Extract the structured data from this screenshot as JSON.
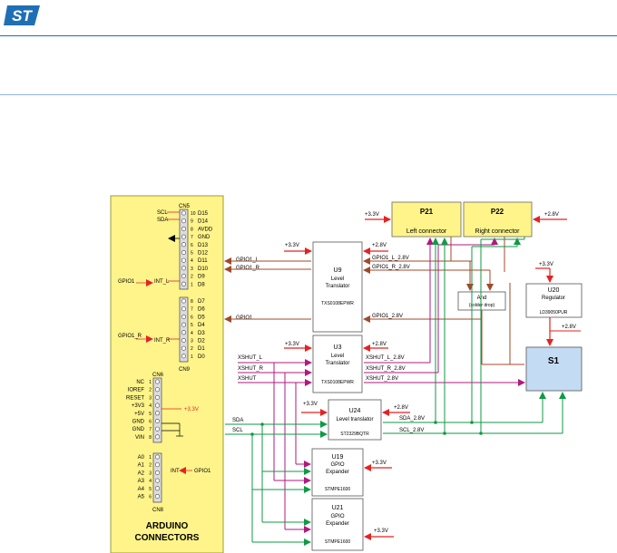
{
  "logo_text": "ST",
  "colors": {
    "yellow": "#fff48a",
    "red": "#e52222",
    "green": "#0f9a46",
    "brown": "#a04a2a",
    "magenta": "#b2187f",
    "blue": "#1f6fb5",
    "s1_fill": "#c3dcf3"
  },
  "diagram": {
    "cn5": {
      "title": "CN5",
      "pins": [
        "10",
        "9",
        "8",
        "7",
        "6",
        "5",
        "4",
        "3",
        "2",
        "1"
      ],
      "labels": [
        "D15",
        "D14",
        "AVDD",
        "GND",
        "D13",
        "D12",
        "D11",
        "D10",
        "D9",
        "D8"
      ],
      "side_labels": [
        "SCL",
        "SDA"
      ],
      "int_label": "INT_L",
      "gpio_label": "GPIO1"
    },
    "cn9": {
      "title": "CN9",
      "pins": [
        "8",
        "7",
        "6",
        "5",
        "4",
        "3",
        "2",
        "1"
      ],
      "labels": [
        "D7",
        "D6",
        "D5",
        "D4",
        "D3",
        "D2",
        "D1",
        "D0"
      ],
      "int_label": "INT_R",
      "gpio_label": "GPIO1_R"
    },
    "cn6": {
      "title": "CN6",
      "pins": [
        "1",
        "2",
        "3",
        "4",
        "5",
        "6",
        "7",
        "8"
      ],
      "labels": [
        "NC",
        "IOREF",
        "RESET",
        "+3V3",
        "+5V",
        "GND",
        "GND",
        "VIN"
      ],
      "v33": "+3.3V"
    },
    "cn8": {
      "title": "CN8",
      "pins": [
        "1",
        "2",
        "3",
        "4",
        "5",
        "6"
      ],
      "labels": [
        "A0",
        "A1",
        "A2",
        "A3",
        "A4",
        "A5"
      ],
      "int_label": "INT",
      "gpio_label": "GPIO1"
    },
    "arduino": {
      "line1": "ARDUINO",
      "line2": "CONNECTORS"
    },
    "u9": {
      "name": "U9",
      "line2": "Level",
      "line3": "Translator",
      "part": "TXS0108EPWR"
    },
    "u3": {
      "name": "U3",
      "line2": "Level",
      "line3": "Translator",
      "part": "TXS0108EPWR"
    },
    "u24": {
      "name": "U24",
      "line2": "Level translator",
      "part": "ST2329BQTR"
    },
    "u19": {
      "name": "U19",
      "line2": "GPIO",
      "line3": "Expander",
      "part": "STMPE1600"
    },
    "u21": {
      "name": "U21",
      "line2": "GPIO",
      "line3": "Expander",
      "part": "STMPE1600"
    },
    "u20": {
      "name": "U20",
      "line2": "Regulator",
      "part": "LD39050PUR"
    },
    "p21": {
      "name": "P21",
      "sub": "Left connector"
    },
    "p22": {
      "name": "P22",
      "sub": "Right connector"
    },
    "and": {
      "line1": "And",
      "line2": "(solder drop)"
    },
    "s1": {
      "name": "S1"
    },
    "nets": {
      "v33": "+3.3V",
      "v28": "+2.8V",
      "gpio1_l": "GPIO1_L",
      "gpio1_r": "GPIO1_R",
      "gpio1": "GPIO1",
      "gpio1_l_28": "GPIO1_L_2.8V",
      "gpio1_r_28": "GPIO1_R_2.8V",
      "gpio1_28": "GPIO1_2.8V",
      "xshut_l": "XSHUT_L",
      "xshut_r": "XSHUT_R",
      "xshut": "XSHUT",
      "xshut_l_28": "XSHUT_L_2.8V",
      "xshut_r_28": "XSHUT_R_2.8V",
      "xshut_28": "XSHUT_2.8V",
      "sda": "SDA",
      "scl": "SCL",
      "sda_28": "SDA_2.8V",
      "scl_28": "SCL_2.8V"
    }
  }
}
